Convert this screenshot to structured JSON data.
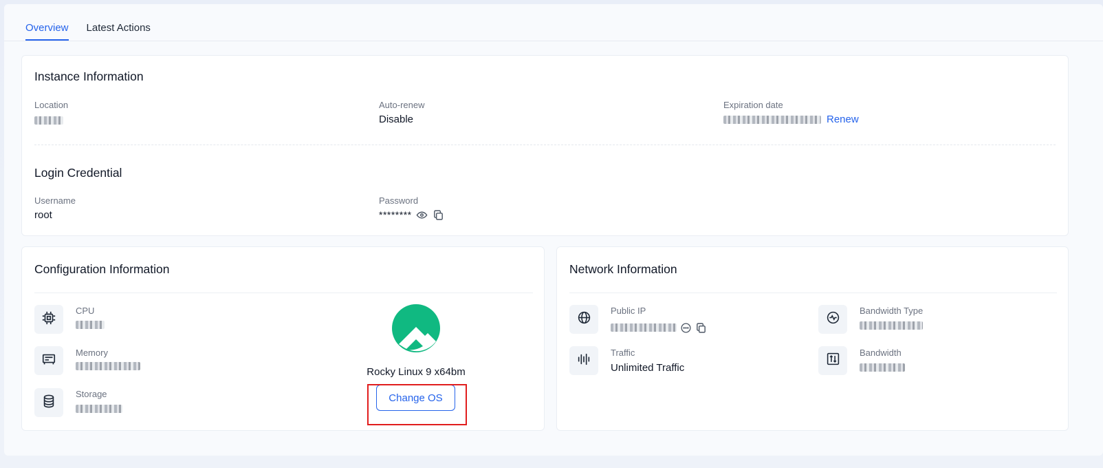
{
  "tabs": [
    {
      "label": "Overview",
      "active": true
    },
    {
      "label": "Latest Actions",
      "active": false
    }
  ],
  "instance": {
    "title": "Instance Information",
    "location_label": "Location",
    "auto_renew_label": "Auto-renew",
    "auto_renew_value": "Disable",
    "expiration_label": "Expiration date",
    "renew_link": "Renew"
  },
  "login": {
    "title": "Login Credential",
    "username_label": "Username",
    "username_value": "root",
    "password_label": "Password",
    "password_value": "********"
  },
  "config": {
    "title": "Configuration Information",
    "cpu_label": "CPU",
    "memory_label": "Memory",
    "storage_label": "Storage",
    "os_name": "Rocky Linux 9 x64bm",
    "change_os_button": "Change OS"
  },
  "network": {
    "title": "Network Information",
    "public_ip_label": "Public IP",
    "bandwidth_type_label": "Bandwidth Type",
    "traffic_label": "Traffic",
    "traffic_value": "Unlimited Traffic",
    "bandwidth_label": "Bandwidth"
  },
  "colors": {
    "accent": "#2563eb",
    "os_logo": "#10b981",
    "highlight": "#e11d1d"
  }
}
